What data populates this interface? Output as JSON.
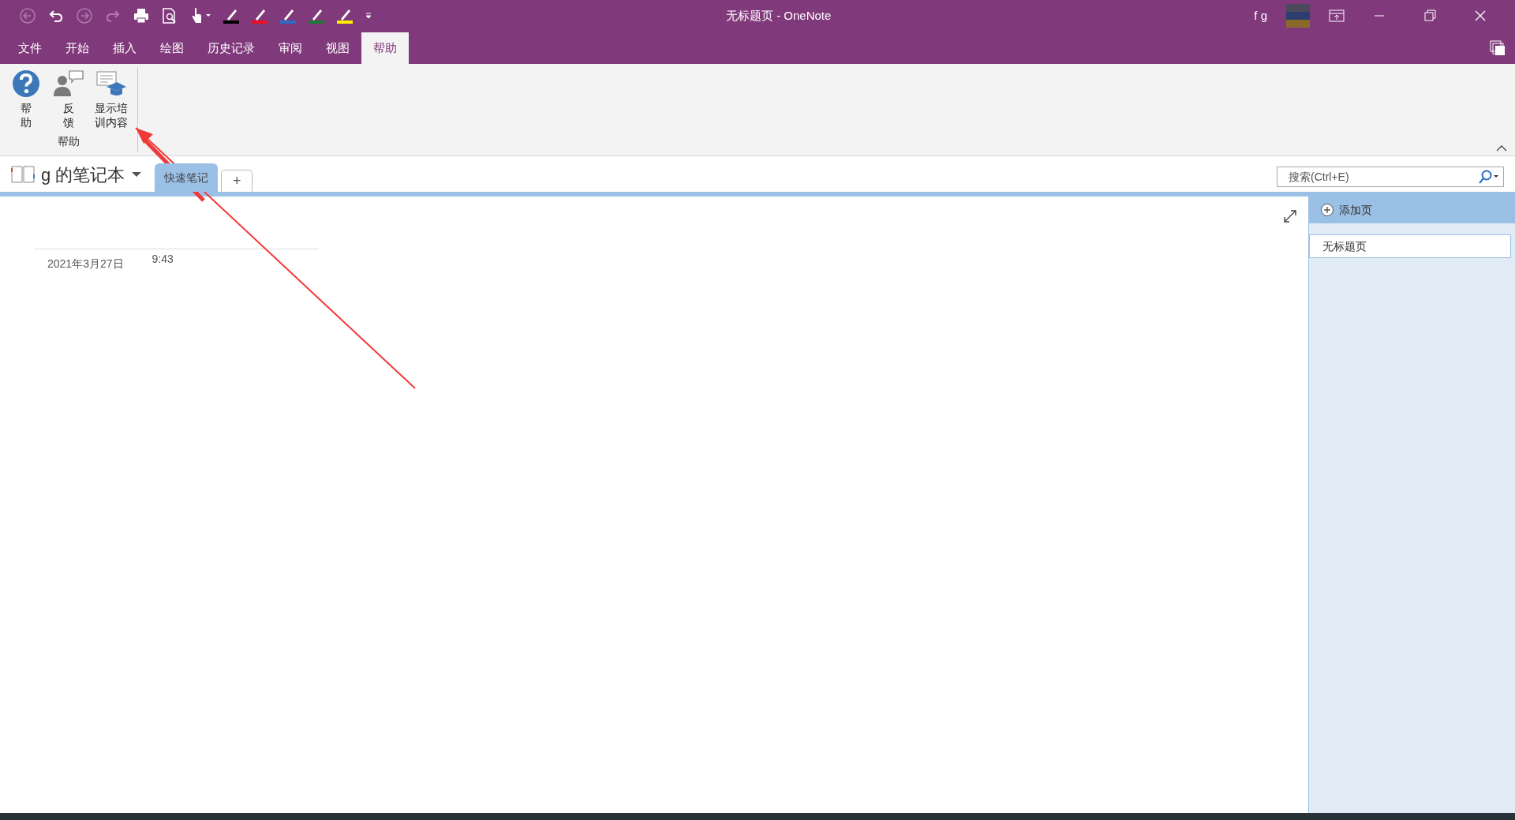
{
  "window": {
    "title": "无标题页 - OneNote",
    "user": "f g"
  },
  "ribbon_tabs": [
    {
      "label": "文件",
      "selected": false
    },
    {
      "label": "开始",
      "selected": false
    },
    {
      "label": "插入",
      "selected": false
    },
    {
      "label": "绘图",
      "selected": false
    },
    {
      "label": "历史记录",
      "selected": false
    },
    {
      "label": "审阅",
      "selected": false
    },
    {
      "label": "视图",
      "selected": false
    },
    {
      "label": "帮助",
      "selected": true
    }
  ],
  "ribbon_group": {
    "label": "帮助",
    "buttons": [
      {
        "kind": "help",
        "label": "帮助"
      },
      {
        "kind": "feedback",
        "label": "反馈"
      },
      {
        "kind": "training",
        "label": "显示培训内容"
      }
    ]
  },
  "notebook": {
    "name": "g 的笔记本",
    "sections": [
      {
        "label": "快速笔记",
        "selected": true
      }
    ],
    "add_section": "+"
  },
  "search": {
    "placeholder": "搜索(Ctrl+E)"
  },
  "page": {
    "date": "2021年3月27日",
    "time": "9:43"
  },
  "pages_pane": {
    "add_page": "添加页",
    "pages": [
      {
        "title": "无标题页",
        "selected": true
      }
    ]
  }
}
